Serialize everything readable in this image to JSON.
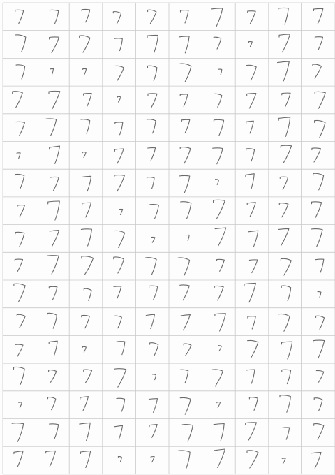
{
  "sheet": {
    "description_tags": [
      "handwritten-digit-sheet"
    ],
    "rows": 17,
    "cols": 10,
    "digit_label": "7",
    "ink_color": "#6a6a6a",
    "grid_color": "#c9c9c9",
    "background_color": "#fdfdfd"
  }
}
